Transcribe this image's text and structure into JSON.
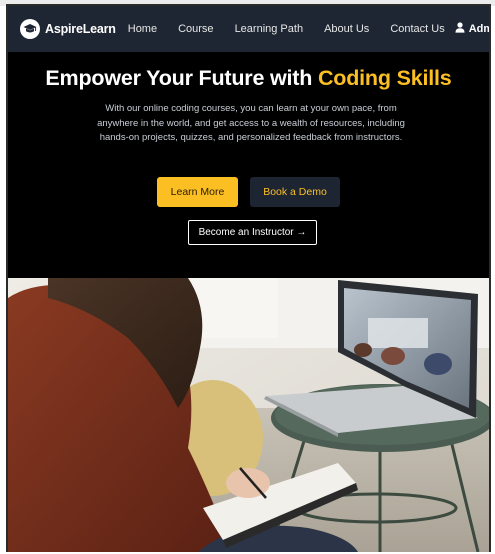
{
  "brand": {
    "name": "AspireLearn",
    "icon": "graduation-cap-icon"
  },
  "nav": {
    "links": [
      "Home",
      "Course",
      "Learning Path",
      "About Us",
      "Contact Us"
    ],
    "user_label": "Admin",
    "user_icon": "user-icon",
    "dropdown_icon": "chevron-down-icon"
  },
  "hero": {
    "title_main": "Empower Your Future with",
    "title_highlight": "Coding Skills",
    "description": "With our online coding courses, you can learn at your own pace, from anywhere in the world, and get access to a wealth of resources, including hands-on projects, quizzes, and personalized feedback from instructors.",
    "primary_button": "Learn More",
    "secondary_button": "Book a Demo",
    "outline_button": "Become an Instructor →"
  },
  "colors": {
    "accent": "#fbbf24",
    "navbar_bg": "#1f2633",
    "hero_bg": "#000000"
  }
}
